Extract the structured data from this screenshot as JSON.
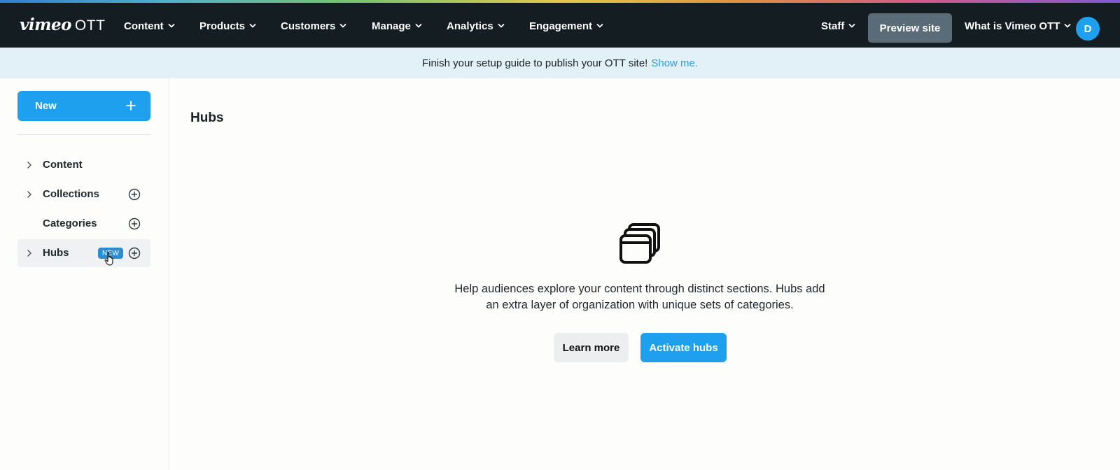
{
  "app": {
    "logo_primary": "vimeo",
    "logo_secondary": "OTT"
  },
  "nav": {
    "items": [
      {
        "label": "Content",
        "icon": "chevron-down-icon"
      },
      {
        "label": "Products",
        "icon": "chevron-down-icon"
      },
      {
        "label": "Customers",
        "icon": "chevron-down-icon"
      },
      {
        "label": "Manage",
        "icon": "chevron-down-icon"
      },
      {
        "label": "Analytics",
        "icon": "chevron-down-icon"
      },
      {
        "label": "Engagement",
        "icon": "chevron-down-icon"
      }
    ],
    "staff_label": "Staff",
    "preview_label": "Preview site",
    "whatis_label": "What is Vimeo OTT",
    "avatar_initial": "D"
  },
  "banner": {
    "text": "Finish your setup guide to publish your OTT site!",
    "link": "Show me."
  },
  "sidebar": {
    "new_label": "New",
    "items": [
      {
        "label": "Content",
        "expandable": true,
        "addable": false
      },
      {
        "label": "Collections",
        "expandable": true,
        "addable": true
      },
      {
        "label": "Categories",
        "expandable": false,
        "addable": true
      },
      {
        "label": "Hubs",
        "expandable": true,
        "addable": true,
        "badge": "NEW",
        "active": true
      }
    ]
  },
  "main": {
    "title": "Hubs",
    "empty_state": {
      "icon": "stacked-windows-icon",
      "line1": "Help audiences explore your content through distinct sections. Hubs add",
      "line2": "an extra layer of organization with unique sets of categories.",
      "secondary_button": "Learn more",
      "primary_button": "Activate hubs"
    }
  },
  "colors": {
    "nav_bg": "#131d22",
    "accent": "#1ea0ee",
    "banner_bg": "#e2f0f7",
    "link": "#2f9ede",
    "preview_btn": "#5a6c78"
  }
}
